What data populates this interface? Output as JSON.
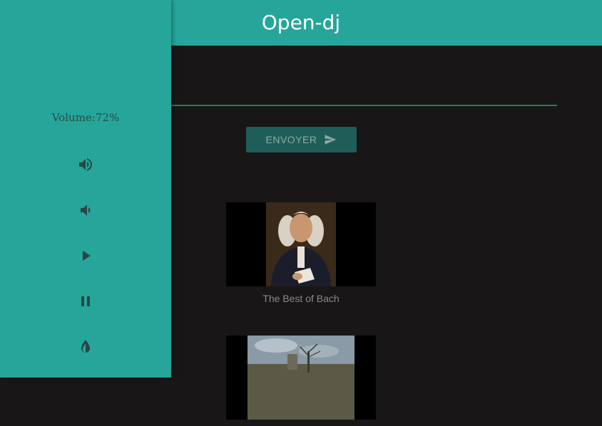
{
  "header": {
    "title": "Open-dj"
  },
  "sidebar": {
    "volume_label": "Volume:72%",
    "controls": [
      {
        "icon": "volume-up-icon"
      },
      {
        "icon": "volume-down-icon"
      },
      {
        "icon": "play-icon"
      },
      {
        "icon": "pause-icon"
      },
      {
        "icon": "contrast-icon"
      }
    ]
  },
  "main": {
    "send_label": "ENVOYER",
    "videos": [
      {
        "title": "The Best of Bach"
      },
      {
        "title": ""
      }
    ]
  },
  "colors": {
    "accent": "#26a69a",
    "background": "#181616",
    "button": "#1f5e58",
    "input_underline": "#2e7d4f"
  }
}
